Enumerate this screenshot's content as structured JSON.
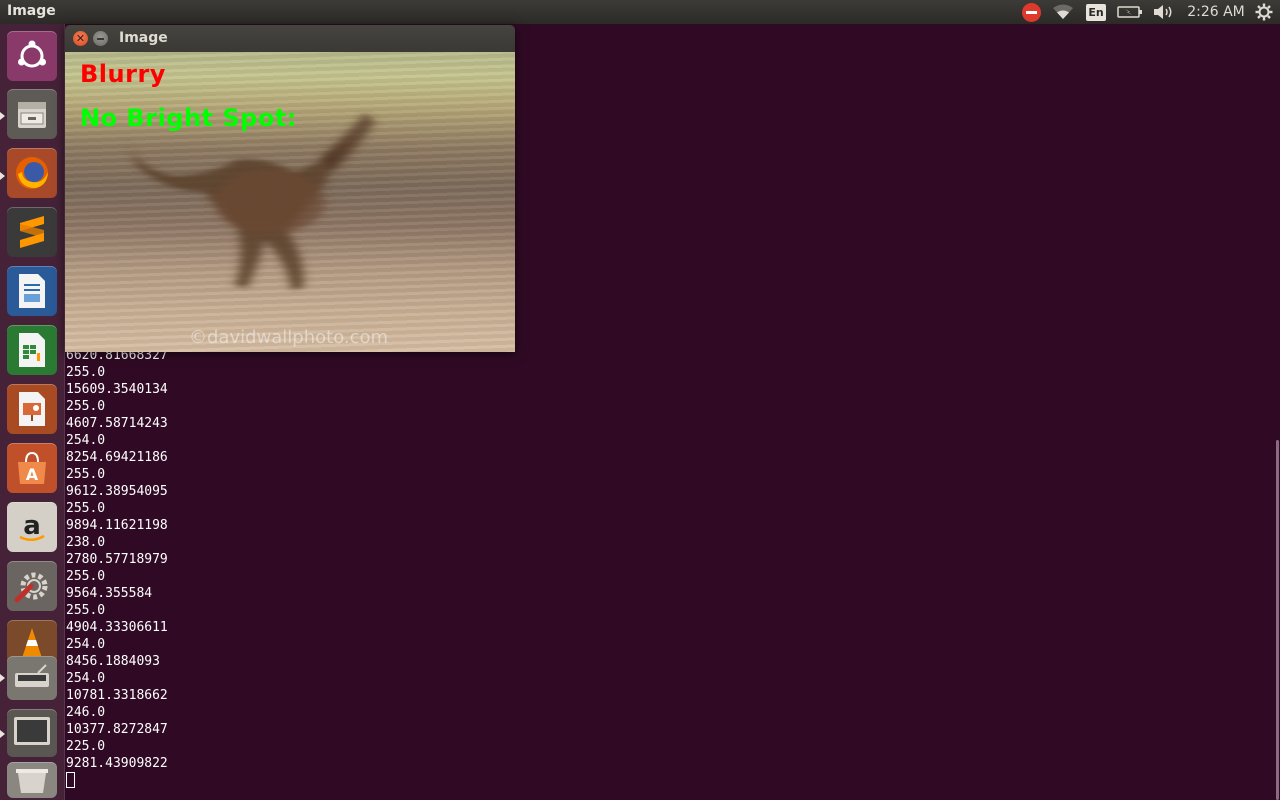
{
  "top_panel": {
    "title": "Image",
    "keyboard_layout": "En",
    "clock": "2:26 AM"
  },
  "launcher": {
    "items": [
      {
        "name": "ubuntu-dash",
        "icon": "ubuntu-logo-icon",
        "color": "#8a3a6a"
      },
      {
        "name": "files",
        "icon": "file-cabinet-icon",
        "color": "#6a6560"
      },
      {
        "name": "firefox",
        "icon": "firefox-icon",
        "color": "#e66000"
      },
      {
        "name": "sublime-text",
        "icon": "sublime-text-icon",
        "color": "#4a4a4a"
      },
      {
        "name": "libreoffice-writer",
        "icon": "writer-document-icon",
        "color": "#2a6aa8"
      },
      {
        "name": "libreoffice-calc",
        "icon": "calc-spreadsheet-icon",
        "color": "#2f8a3a"
      },
      {
        "name": "libreoffice-impress",
        "icon": "impress-presentation-icon",
        "color": "#c0552a"
      },
      {
        "name": "software-center",
        "icon": "shopping-bag-icon",
        "color": "#e06a2a"
      },
      {
        "name": "amazon",
        "icon": "amazon-icon",
        "color": "#d8d4cc"
      },
      {
        "name": "system-settings",
        "icon": "wrench-gear-icon",
        "color": "#7a7570"
      },
      {
        "name": "vlc",
        "icon": "traffic-cone-icon",
        "color": "#f08a00"
      },
      {
        "name": "scanner",
        "icon": "scanner-icon",
        "color": "#8a8680"
      },
      {
        "name": "terminal-window",
        "icon": "monitor-icon",
        "color": "#5a5a5a"
      },
      {
        "name": "trash",
        "icon": "trash-icon",
        "color": "#a8a49e"
      }
    ]
  },
  "image_window": {
    "title": "Image",
    "overlay_blurry": "Blurry",
    "overlay_blurry_color": "#ff0000",
    "overlay_spot": "No Bright Spot:",
    "overlay_spot_color": "#00ff00",
    "watermark": "©davidwallphoto.com"
  },
  "terminal": {
    "lines": [
      "6620.81668327",
      "255.0",
      "15609.3540134",
      "255.0",
      "4607.58714243",
      "254.0",
      "8254.69421186",
      "255.0",
      "9612.38954095",
      "255.0",
      "9894.11621198",
      "238.0",
      "2780.57718979",
      "255.0",
      "9564.355584",
      "255.0",
      "4904.33306611",
      "254.0",
      "8456.1884093",
      "254.0",
      "10781.3318662",
      "246.0",
      "10377.8272847",
      "225.0",
      "9281.43909822"
    ]
  }
}
